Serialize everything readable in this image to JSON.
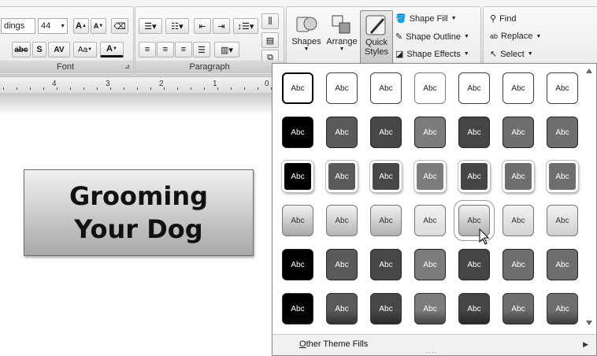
{
  "font_group": {
    "font_name": "dings",
    "font_size": "44",
    "grow_font": "A",
    "shrink_font": "A",
    "strike": "abc",
    "shadow": "S",
    "spacing": "AV",
    "change_case": "Aa",
    "font_color": "A",
    "label": "Font"
  },
  "paragraph_group": {
    "label": "Paragraph"
  },
  "drawing_group": {
    "shapes_label": "Shapes",
    "arrange_label": "Arrange",
    "quick_label_1": "Quick",
    "quick_label_2": "Styles",
    "shape_fill": "Shape Fill",
    "shape_outline": "Shape Outline",
    "shape_effects": "Shape Effects"
  },
  "editing_group": {
    "find": "Find",
    "replace": "Replace",
    "select": "Select"
  },
  "ruler": {
    "numbers": [
      "4",
      "3",
      "2",
      "1",
      "0"
    ]
  },
  "slide": {
    "title_line1": "Grooming",
    "title_line2": "Your Dog"
  },
  "gallery": {
    "swatch_text": "Abc",
    "footer_prefix": "O",
    "footer_rest": "ther Theme Fills",
    "grip": "....",
    "rows": [
      [
        "#000000",
        "#3c3c3c",
        "#3c3c3c",
        "#7a7a7a",
        "#3c3c3c",
        "#3c3c3c",
        "#3c3c3c"
      ],
      [
        "#000000",
        "#5a5a5a",
        "#474747",
        "#7c7c7c",
        "#454545",
        "#6e6e6e",
        "#6e6e6e"
      ],
      [
        "#000000",
        "#5a5a5a",
        "#474747",
        "#7c7c7c",
        "#454545",
        "#6e6e6e",
        "#6e6e6e"
      ],
      [
        "#a8a8a8",
        "#b5b5b5",
        "#b0b0b0",
        "#dddddd",
        "#b0b0b0",
        "#d4d4d4",
        "#cfcfcf"
      ],
      [
        "#000000",
        "#5a5a5a",
        "#474747",
        "#7c7c7c",
        "#454545",
        "#6e6e6e",
        "#6e6e6e"
      ],
      [
        "#000000",
        "#5a5a5a",
        "#474747",
        "#7c7c7c",
        "#454545",
        "#6e6e6e",
        "#6e6e6e"
      ]
    ],
    "highlighted": {
      "row": 3,
      "col": 4
    }
  }
}
